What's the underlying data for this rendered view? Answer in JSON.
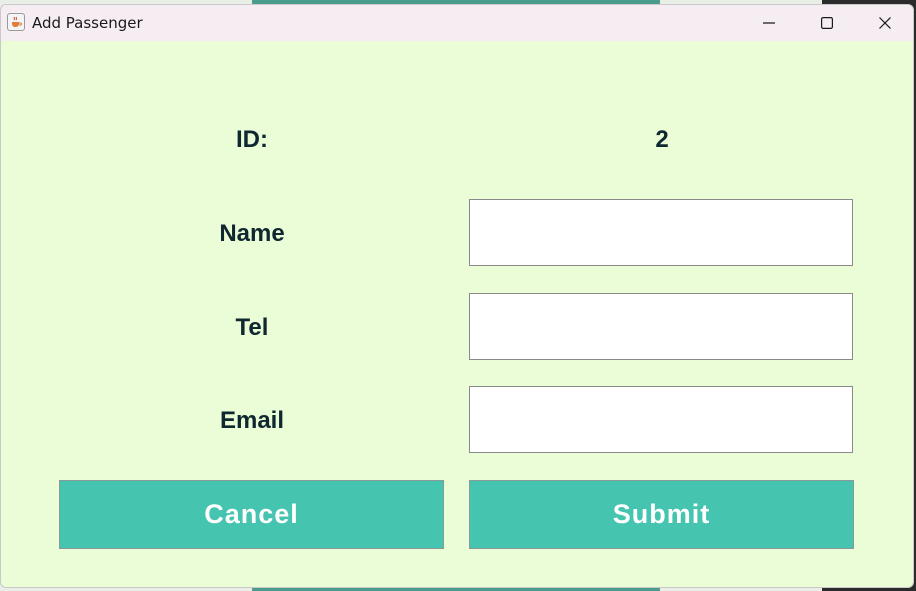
{
  "window": {
    "title": "Add Passenger",
    "icon": "java-cup-icon",
    "controls": [
      "minimize-icon",
      "maximize-icon",
      "close-icon"
    ]
  },
  "form": {
    "id_label": "ID:",
    "id_value": "2",
    "name_label": "Name",
    "name_value": "",
    "tel_label": "Tel",
    "tel_value": "",
    "email_label": "Email",
    "email_value": ""
  },
  "actions": {
    "cancel_label": "Cancel",
    "submit_label": "Submit"
  },
  "colors": {
    "window_bg": "#ebfdd6",
    "titlebar_bg": "#f6edf3",
    "button_bg": "#45c4b0",
    "label_text": "#0f2730"
  }
}
